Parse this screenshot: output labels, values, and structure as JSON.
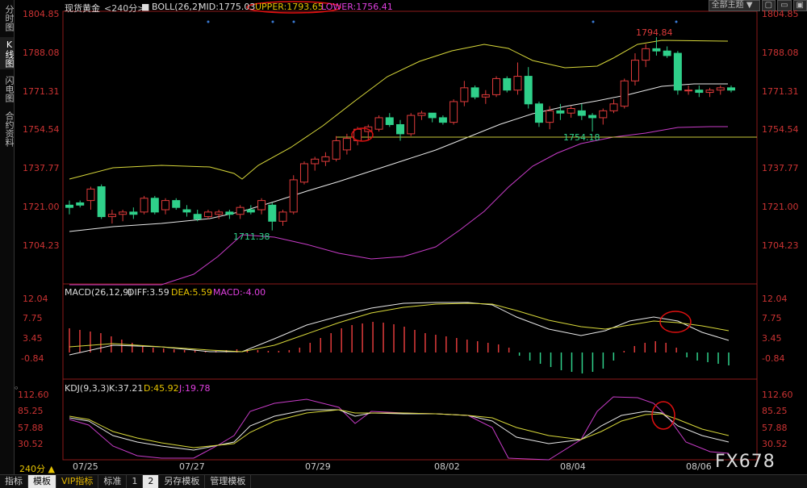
{
  "sidebar": {
    "tabs": [
      {
        "label": "分时图",
        "active": false
      },
      {
        "label": "K线图",
        "active": true
      },
      {
        "label": "闪电图",
        "active": false
      },
      {
        "label": "合约资料",
        "active": false
      }
    ]
  },
  "header": {
    "symbol": "现货黄金",
    "period": "<240分>",
    "boll_label": "BOLL(26,2)",
    "mid": "MID:1775.03",
    "upper": "UPPER:1793.65",
    "lower": "LOWER:1756.41",
    "theme_select": "全部主题",
    "buttons": [
      "▼",
      "▢",
      "▭",
      "▣"
    ]
  },
  "price_axis": {
    "labels": [
      "1804.85",
      "1788.08",
      "1771.31",
      "1754.54",
      "1737.77",
      "1721.00",
      "1704.23"
    ]
  },
  "annotations": {
    "high": "1794.84",
    "low": "1711.38",
    "level": "1754.18"
  },
  "macd": {
    "title": "MACD(26,12,9)",
    "diff": "DIFF:3.59",
    "dea": "DEA:5.59",
    "macd": "MACD:-4.00",
    "axis": [
      "12.04",
      "7.75",
      "3.45",
      "-0.84"
    ]
  },
  "kdj": {
    "title": "KDJ(9,3,3)",
    "k": "K:37.21",
    "d": "D:45.92",
    "j": "J:19.78",
    "axis": [
      "112.60",
      "85.25",
      "57.88",
      "30.52"
    ]
  },
  "x_axis": {
    "period_label": "240分 ▲",
    "dates": [
      "07/25",
      "07/27",
      "07/29",
      "08/02",
      "08/04",
      "08/06"
    ]
  },
  "bottom_tabs": [
    {
      "label": "指标",
      "active": false,
      "vip": false
    },
    {
      "label": "模板",
      "active": true,
      "vip": false
    },
    {
      "label": "VIP指标",
      "active": false,
      "vip": true
    },
    {
      "label": "标准",
      "active": false,
      "vip": false
    },
    {
      "label": "1",
      "active": false,
      "vip": false
    },
    {
      "label": "2",
      "active": true,
      "vip": false
    },
    {
      "label": "另存模板",
      "active": false,
      "vip": false
    },
    {
      "label": "管理模板",
      "active": false,
      "vip": false
    }
  ],
  "watermark": "FX678",
  "colors": {
    "up": "#e03b3b",
    "down": "#2fd08a",
    "boll_upper": "#d8d83a",
    "boll_mid": "#e8e8e8",
    "boll_lower": "#c83cc8",
    "axis_text": "#cc3333",
    "annotation_circle": "#e01010"
  }
}
